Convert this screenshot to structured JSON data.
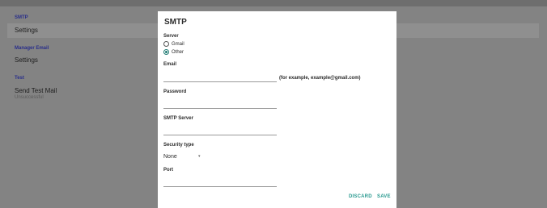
{
  "sidebar": {
    "smtp_section": "SMTP",
    "smtp_item": "Settings",
    "manager_section": "Manager Email",
    "manager_item": "Settings",
    "test_section": "Test",
    "test_item": "Send Test Mail",
    "test_status": "Unsuccessful"
  },
  "dialog": {
    "title": "SMTP",
    "server_label": "Server",
    "server_options": [
      "Gmail",
      "Other"
    ],
    "server_selected": "Other",
    "email_label": "Email",
    "email_value": "",
    "email_hint": "(for example, example@gmail.com)",
    "password_label": "Password",
    "password_value": "",
    "smtp_server_label": "SMTP Server",
    "smtp_server_value": "",
    "security_label": "Security type",
    "security_value": "None",
    "port_label": "Port",
    "port_value": "",
    "discard_label": "DISCARD",
    "save_label": "SAVE"
  },
  "colors": {
    "accent": "#2a9a90",
    "section_header": "#2a2f8a",
    "overlay_background": "#838383"
  },
  "icons": {
    "select_chevron": "chevron-down-icon"
  }
}
